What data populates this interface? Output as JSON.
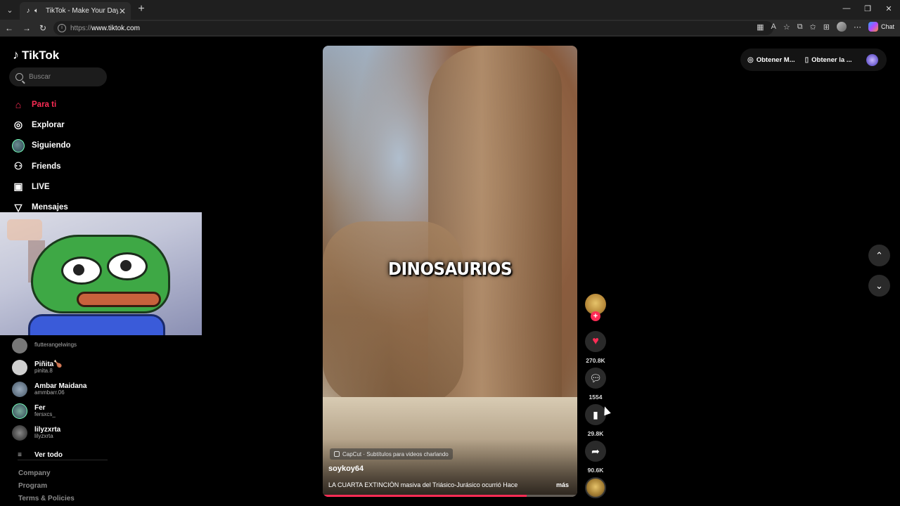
{
  "browser": {
    "tab_title": "TikTok - Make Your Day",
    "url_protocol": "https://",
    "url_host": "www.tiktok.com",
    "chat_label": "Chat"
  },
  "sidebar": {
    "logo": "TikTok",
    "search_placeholder": "Buscar",
    "nav": [
      {
        "label": "Para ti",
        "icon": "home-icon",
        "active": true
      },
      {
        "label": "Explorar",
        "icon": "compass-icon"
      },
      {
        "label": "Siguiendo",
        "icon": "avatar-icon"
      },
      {
        "label": "Friends",
        "icon": "friends-icon"
      },
      {
        "label": "LIVE",
        "icon": "live-icon"
      },
      {
        "label": "Mensajes",
        "icon": "messages-icon"
      }
    ],
    "following": [
      {
        "name": "",
        "user": "flutterangelwings"
      },
      {
        "name": "Piñita🍗",
        "user": "pinita.8"
      },
      {
        "name": "Ambar Maidana",
        "user": "ammbarr.06"
      },
      {
        "name": "Fer",
        "user": "fersxcs_"
      },
      {
        "name": "lilyzxrta",
        "user": "lilyzxrta"
      }
    ],
    "see_all": "Ver todo",
    "footer": [
      "Company",
      "Program",
      "Terms & Policies"
    ]
  },
  "video": {
    "overlay_title": "DINOSAURIOS",
    "capcut_label": "CapCut · Subtítulos para videos charlando",
    "author": "soykoy64",
    "caption": "LA CUARTA EXTINCIÓN masiva del Triásico-Jurásico ocurrió Hace",
    "more": "más",
    "progress": 0.8
  },
  "actions": {
    "likes": "270.8K",
    "comments": "1554",
    "saves": "29.8K",
    "shares": "90.6K"
  },
  "topbar": {
    "get_coins": "Obtener M...",
    "get_app": "Obtener la ..."
  },
  "colors": {
    "accent": "#fe2c55",
    "background": "#000000"
  }
}
